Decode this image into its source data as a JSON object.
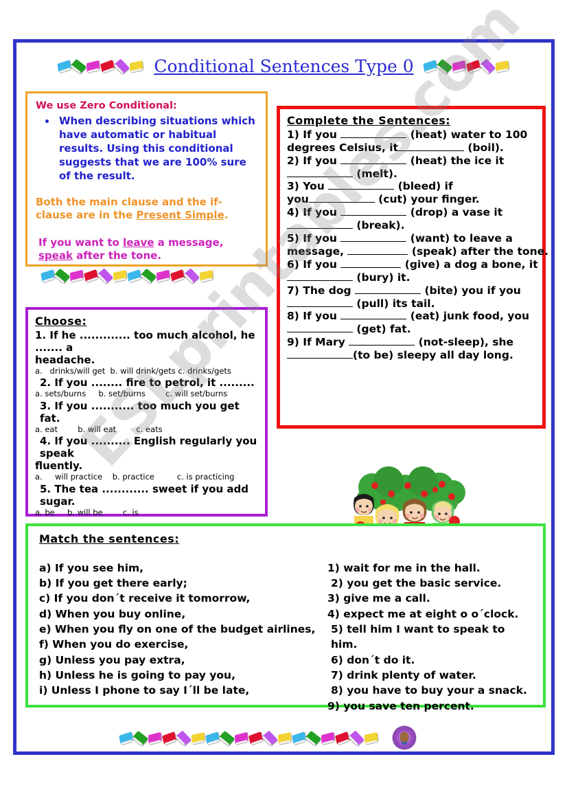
{
  "header": {
    "title": "Conditional Sentences Type 0"
  },
  "watermark": {
    "text": "ESLprintables.com"
  },
  "colors": {
    "page_border": "#3333cc",
    "info_border": "#f0a124",
    "choose_border": "#a81fd4",
    "complete_border": "#ee1111",
    "match_border": "#3ee03e",
    "title": "#2a2ad0",
    "info_heading": "#d1105a",
    "info_bullet": "#2222cc",
    "info_para": "#f0932a",
    "info_example": "#cc22bb"
  },
  "book_colors": [
    "#3ab6e8",
    "#22a023",
    "#dd33cc",
    "#e01030",
    "#c055ee",
    "#f2d433"
  ],
  "info": {
    "heading": "We use Zero Conditional:",
    "bullets": [
      "When describing situations which have automatic or habitual results. Using this conditional suggests that we are 100% sure of the result."
    ],
    "paragraph_pre": "Both the main clause and the if-clause are in the ",
    "paragraph_underlined": "Present Simple",
    "paragraph_post": ".",
    "example_pre": "If you want to ",
    "example_u1": "leave",
    "example_mid": " a message, ",
    "example_u2": "speak",
    "example_post": " after the tone."
  },
  "complete": {
    "heading": "Complete the Sentences:",
    "items": [
      {
        "num": "1)",
        "a": "If you",
        "v1": "(heat)",
        "b": "water to 100 degrees Celsius, it",
        "v2": "(boil)."
      },
      {
        "num": "2)",
        "a": "If you",
        "v1": "(heat)",
        "b": "the ice it",
        "v2": "(melt)."
      },
      {
        "num": "3)",
        "a": "You",
        "v1": "(bleed)",
        "b": "if you",
        "v2": "(cut) your finger."
      },
      {
        "num": "4)",
        "a": "If you",
        "v1": "(drop)",
        "b": "a vase it",
        "v2": "(break)."
      },
      {
        "num": "5)",
        "a": "If you",
        "v1": "(want)",
        "b": "to leave a message,",
        "v2": "(speak) after the tone."
      },
      {
        "num": "6)",
        "a": "If you",
        "v1": "(give)",
        "b": "a dog a bone, it",
        "v2": "(bury) it."
      },
      {
        "num": "7)",
        "a": "The dog",
        "v1": "(bite)",
        "b": "you if you",
        "v2": "(pull) its tail."
      },
      {
        "num": "8)",
        "a": "If you",
        "v1": "(eat)",
        "b": "junk food, you",
        "v2": "(get) fat."
      },
      {
        "num": "9)",
        "a": "If Mary",
        "v1": "(not-sleep),",
        "b": "she",
        "v2": "(to be) sleepy all day long."
      }
    ],
    "l1a": "1) If you",
    "l1b": "(heat) water to 100",
    "l1c": "degrees Celsius, it",
    "l1d": "(boil).",
    "l2a": "2) If you",
    "l2b": "(heat) the ice it",
    "l2c": "(melt).",
    "l3a": "3) You",
    "l3b": "(bleed) if",
    "l3c": "you",
    "l3d": "(cut) your finger.",
    "l4a": "4) If you",
    "l4b": "(drop) a vase it",
    "l4c": "(break).",
    "l5a": "5) If you",
    "l5b": "(want) to leave a",
    "l5c": "message,",
    "l5d": "(speak) after the tone.",
    "l6a": "6) If you",
    "l6b": "(give) a dog a bone, it",
    "l6c": "(bury) it.",
    "l7a": "7) The dog",
    "l7b": "(bite) you if you",
    "l7c": "(pull) its tail.",
    "l8a": "8) If you",
    "l8b": "(eat) junk food, you",
    "l8c": "(get) fat.",
    "l9a": "9) If Mary",
    "l9b": "(not-sleep), she",
    "l9c": "(to be) sleepy all day long."
  },
  "choose": {
    "heading": "Choose:",
    "q1_l1": "1. If he ............. too much alcohol, he ....... a",
    "q1_l2": "headache.",
    "q1_opts": "a.   drinks/will get  b. will drink/gets c. drinks/gets",
    "q2_l1": " 2. If you ........ fire to petrol, it .........",
    "q2_opts": "a. sets/burns     b. set/burns        c. will set/burns",
    "q3_l1": " 3. If you ........... too much you get fat.",
    "q3_opts": "a. eat        b. will eat        c. eats",
    "q4_l1": " 4. If you .......... English regularly you speak",
    "q4_l2": "fluently.",
    "q4_opts": "a.     will practice    b. practice         c. is practicing",
    "q5_l1": " 5. The tea ............ sweet if you add sugar.",
    "q5_opts": "a. be     b. will be        c. is"
  },
  "match": {
    "heading": "Match the sentences:",
    "left": [
      "a) If you see him,",
      "b) If you get there early;",
      "c) If you don´t receive it tomorrow,",
      "d) When you buy online,",
      "e) When you fly on one of the budget airlines,",
      "f) When you do exercise,",
      "g) Unless you pay extra,",
      "h) Unless he is going to pay you,",
      "i) Unless I phone to say I´ll be late,"
    ],
    "right": [
      "1) wait for me in the hall.",
      "2) you get the basic service.",
      "3) give me a call.",
      "4) expect me at eight o o´clock.",
      "5) tell him I want to speak to him.",
      "6) don´t do it.",
      "7) drink plenty of water.",
      "8) you have to buy your a snack.",
      "9) you save ten percent."
    ]
  },
  "clipart": {
    "kids": "four-children-with-apples-in-front-of-apple-trees",
    "badge": "eslprintables-author-badge"
  }
}
